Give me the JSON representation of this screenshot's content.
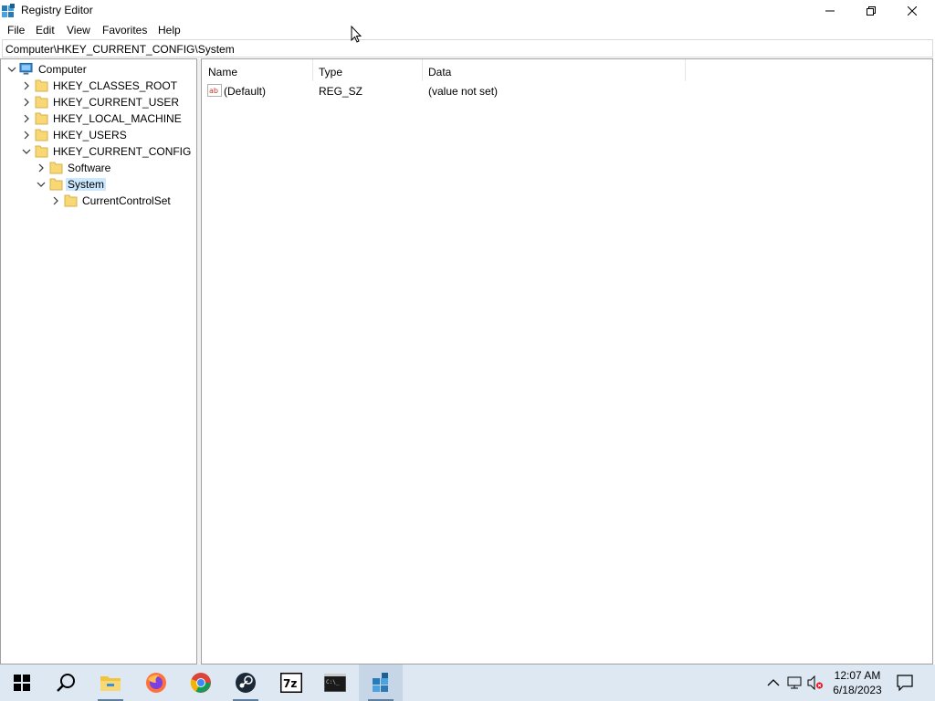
{
  "window": {
    "title": "Registry Editor"
  },
  "menu": [
    "File",
    "Edit",
    "View",
    "Favorites",
    "Help"
  ],
  "address": "Computer\\HKEY_CURRENT_CONFIG\\System",
  "tree": {
    "root": "Computer",
    "hkey_classes_root": "HKEY_CLASSES_ROOT",
    "hkey_current_user": "HKEY_CURRENT_USER",
    "hkey_local_machine": "HKEY_LOCAL_MACHINE",
    "hkey_users": "HKEY_USERS",
    "hkey_current_config": "HKEY_CURRENT_CONFIG",
    "software": "Software",
    "system": "System",
    "current_control_set": "CurrentControlSet"
  },
  "list": {
    "columns": [
      "Name",
      "Type",
      "Data"
    ],
    "rows": [
      {
        "name": "(Default)",
        "type": "REG_SZ",
        "data": "(value not set)"
      }
    ]
  },
  "taskbar": {
    "apps": [
      "start-icon",
      "search-icon",
      "file-explorer-icon",
      "firefox-icon",
      "chrome-icon",
      "steam-icon",
      "7zip-icon",
      "terminal-icon",
      "registry-editor-icon"
    ],
    "time": "12:07 AM",
    "date": "6/18/2023"
  },
  "colors": {
    "selection": "#cce8ff",
    "folder": "#f8d775",
    "taskbar": "#dde8f3"
  }
}
